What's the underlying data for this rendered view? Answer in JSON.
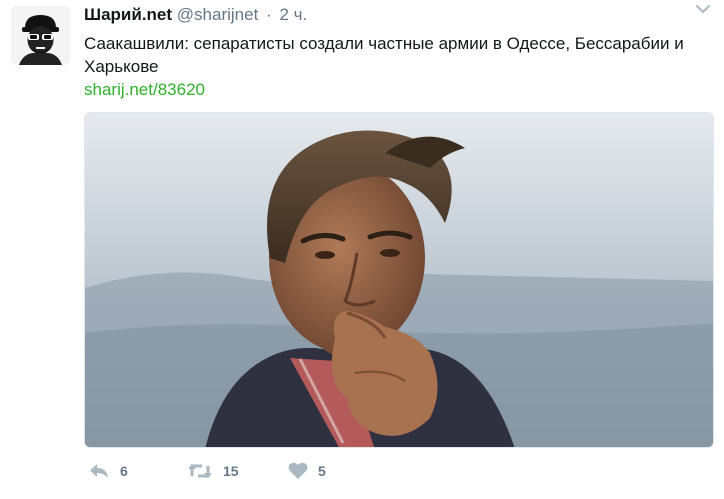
{
  "tweet": {
    "author_name": "Шарий.net",
    "handle": "@sharijnet",
    "separator": "·",
    "time": "2 ч.",
    "text": "Саакашвили: сепаратисты создали частные армии в Одессе, Бессарабии и Харькове",
    "link": "sharij.net/83620",
    "media_icon": "photo-of-man-with-hand-to-mouth"
  },
  "actions": {
    "reply_count": "6",
    "retweet_count": "15",
    "like_count": "5",
    "icons": [
      "reply-icon",
      "retweet-icon",
      "heart-icon"
    ]
  },
  "colors": {
    "link": "#2fb12b",
    "muted": "#657786",
    "icon": "#aab8c2"
  }
}
